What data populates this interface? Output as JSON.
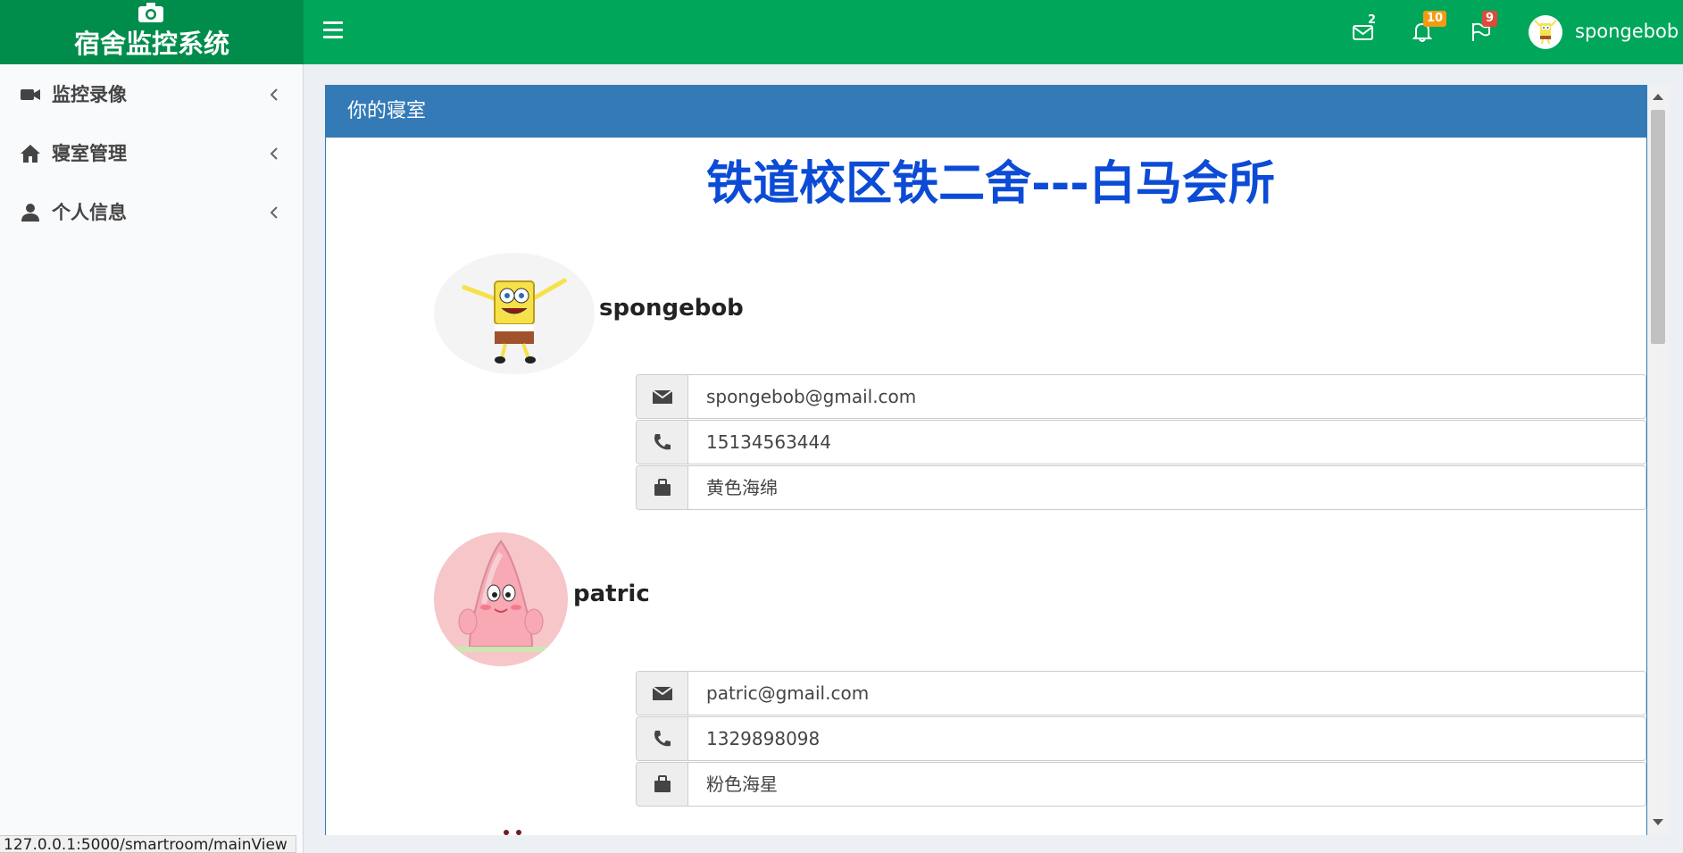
{
  "header": {
    "app_title": "宿舍监控系统",
    "logo_icon": "camera-icon",
    "menu_icon": "hamburger-icon",
    "messages": {
      "icon": "envelope-icon",
      "count": "2"
    },
    "notifications": {
      "icon": "bell-icon",
      "count": "10",
      "color": "#f39c12"
    },
    "tasks": {
      "icon": "flag-icon",
      "count": "9",
      "color": "#dd4b39"
    },
    "user": {
      "name": "spongebob"
    }
  },
  "sidebar": {
    "items": [
      {
        "label": "监控录像",
        "icon": "video-camera-icon"
      },
      {
        "label": "寝室管理",
        "icon": "home-icon"
      },
      {
        "label": "个人信息",
        "icon": "user-icon"
      }
    ]
  },
  "panel": {
    "heading": "你的寝室",
    "dorm_name": "铁道校区铁二舍---白马会所",
    "header_color": "#337ab7",
    "title_color": "#0b4bd6"
  },
  "roommates": [
    {
      "name": "spongebob",
      "email": "spongebob@gmail.com",
      "phone": "15134563444",
      "nickname": "黄色海绵"
    },
    {
      "name": "patric",
      "email": "patric@gmail.com",
      "phone": "1329898098",
      "nickname": "粉色海星"
    }
  ],
  "status_bar": "127.0.0.1:5000/smartroom/mainView",
  "colors": {
    "header_green": "#00a65a",
    "logo_green": "#008d4c"
  }
}
